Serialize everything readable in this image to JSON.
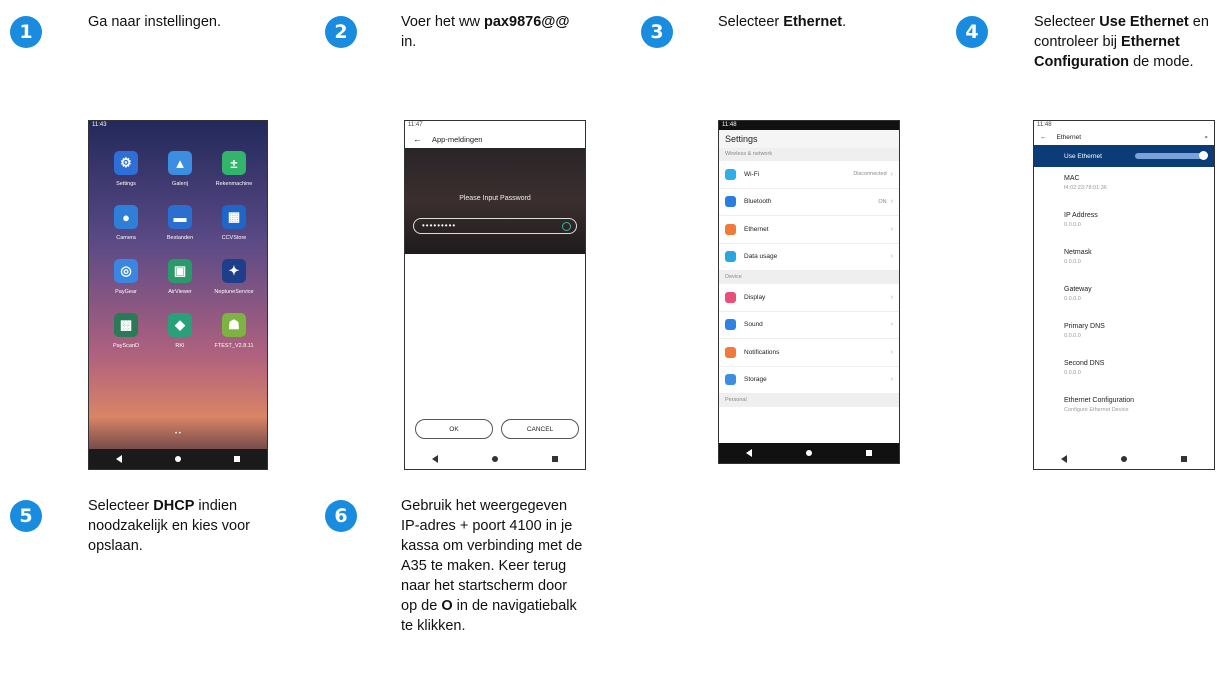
{
  "steps": [
    {
      "num": "1",
      "parts": [
        {
          "t": "Ga naar instellingen.",
          "b": false
        }
      ]
    },
    {
      "num": "2",
      "parts": [
        {
          "t": "Voer het ww ",
          "b": false
        },
        {
          "t": "pax9876@@",
          "b": true
        },
        {
          "t": " in.",
          "b": false
        }
      ]
    },
    {
      "num": "3",
      "parts": [
        {
          "t": "Selecteer ",
          "b": false
        },
        {
          "t": "Ethernet",
          "b": true
        },
        {
          "t": ".",
          "b": false
        }
      ]
    },
    {
      "num": "4",
      "parts": [
        {
          "t": "Selecteer ",
          "b": false
        },
        {
          "t": "Use Ethernet",
          "b": true
        },
        {
          "t": " en controleer bij ",
          "b": false
        },
        {
          "t": "Ethernet Configuration",
          "b": true
        },
        {
          "t": " de mode.",
          "b": false
        }
      ]
    },
    {
      "num": "5",
      "parts": [
        {
          "t": "Selecteer ",
          "b": false
        },
        {
          "t": "DHCP",
          "b": true
        },
        {
          "t": " indien noodzakelijk en kies voor opslaan.",
          "b": false
        }
      ]
    },
    {
      "num": "6",
      "parts": [
        {
          "t": "Gebruik het weergegeven IP-adres + poort 4100 in je kassa om verbinding met de A35 te maken. Keer terug naar het startscherm door op de ",
          "b": false
        },
        {
          "t": "O",
          "b": true
        },
        {
          "t": " in de navigatiebalk te klikken.",
          "b": false
        }
      ]
    }
  ],
  "phone1": {
    "time": "11:43",
    "apps": [
      {
        "label": "Settings",
        "icon": "settings-icon",
        "color": "#2d6fd6",
        "glyph": "⚙"
      },
      {
        "label": "Galerij",
        "icon": "gallery-icon",
        "color": "#3c8ee0",
        "glyph": "▲"
      },
      {
        "label": "Rekenmachine",
        "icon": "calculator-icon",
        "color": "#32b56a",
        "glyph": "±"
      },
      {
        "label": "Camera",
        "icon": "camera-icon",
        "color": "#2f7fd8",
        "glyph": "●"
      },
      {
        "label": "Bestanden",
        "icon": "folder-icon",
        "color": "#2a6fd0",
        "glyph": "▬"
      },
      {
        "label": "CCVStore",
        "icon": "store-icon",
        "color": "#1e66c8",
        "glyph": "▦"
      },
      {
        "label": "PayGear",
        "icon": "paygear-icon",
        "color": "#3b86e0",
        "glyph": "◎"
      },
      {
        "label": "AirViewer",
        "icon": "airviewer-icon",
        "color": "#2a9a6a",
        "glyph": "▣"
      },
      {
        "label": "NeptuneService",
        "icon": "pax-icon",
        "color": "#1d3f8a",
        "glyph": "✦"
      },
      {
        "label": "PayScanD",
        "icon": "qr-icon",
        "color": "#2a7a58",
        "glyph": "▩"
      },
      {
        "label": "RKI",
        "icon": "android-rki-icon",
        "color": "#28a07a",
        "glyph": "◆"
      },
      {
        "label": "FTEST_V2.8.11",
        "icon": "android-icon",
        "color": "#7cb342",
        "glyph": "☗"
      }
    ]
  },
  "phone2": {
    "time": "11:47",
    "title": "App-meldingen",
    "prompt": "Please Input Password",
    "password_mask": "•••••••••",
    "ok": "OK",
    "cancel": "CANCEL"
  },
  "phone3": {
    "time": "11:48",
    "title": "Settings",
    "sections": [
      {
        "header": "Wireless & network",
        "rows": [
          {
            "label": "Wi-Fi",
            "value": "Disconnected",
            "color": "#2db0e8"
          },
          {
            "label": "Bluetooth",
            "value": "ON",
            "color": "#2a7ee0"
          },
          {
            "label": "Ethernet",
            "value": "",
            "color": "#f07a3a"
          },
          {
            "label": "Data usage",
            "value": "",
            "color": "#29a6e0"
          }
        ]
      },
      {
        "header": "Device",
        "rows": [
          {
            "label": "Display",
            "value": "",
            "color": "#e8507a"
          },
          {
            "label": "Sound",
            "value": "",
            "color": "#2d84e0"
          },
          {
            "label": "Notifications",
            "value": "",
            "color": "#f07a3a"
          },
          {
            "label": "Storage",
            "value": "",
            "color": "#3a8fe0"
          }
        ]
      },
      {
        "header": "Personal",
        "rows": []
      }
    ]
  },
  "phone4": {
    "time": "11:48",
    "title": "Ethernet",
    "use_ethernet": "Use Ethernet",
    "items": [
      {
        "label": "MAC",
        "value": "f4:02:23:78:01:36"
      },
      {
        "label": "IP Address",
        "value": "0.0.0.0"
      },
      {
        "label": "Netmask",
        "value": "0.0.0.0"
      },
      {
        "label": "Gateway",
        "value": "0.0.0.0"
      },
      {
        "label": "Primary DNS",
        "value": "0.0.0.0"
      },
      {
        "label": "Second DNS",
        "value": "0.0.0.0"
      },
      {
        "label": "Ethernet Configuration",
        "value": "Configure Ethernet Device"
      }
    ]
  }
}
